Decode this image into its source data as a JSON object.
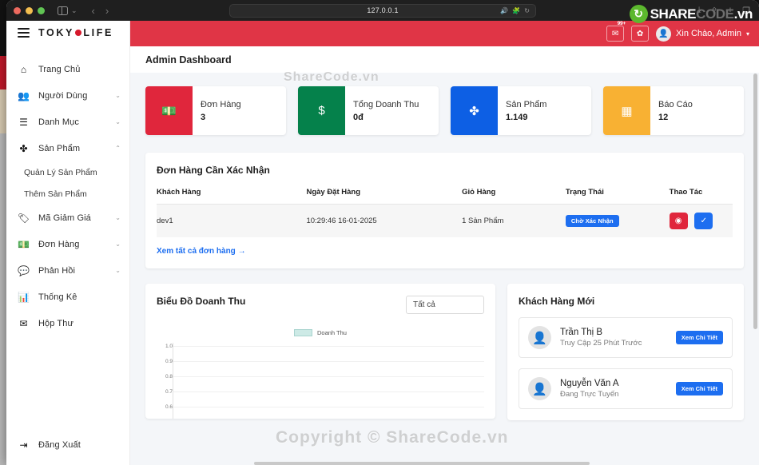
{
  "browser": {
    "url": "127.0.0.1",
    "back_icon": "chevron-left-icon",
    "forward_icon": "chevron-right-icon",
    "sidebar_icon": "sidebar-toggle-icon",
    "sound_icon": "🔊",
    "extension_icon": "🧩",
    "reload_icon": "↻",
    "download_icon": "⤓",
    "share_icon": "⇪",
    "newtab_icon": "+",
    "tabs_icon": "❐"
  },
  "watermark": {
    "badge": "↻",
    "share": "SHARE",
    "code": "CODE",
    "vn": ".vn",
    "top_text": "ShareCode.vn",
    "mid_text": "Copyright © ShareCode.vn"
  },
  "brand": {
    "hamburger_icon": "menu-icon",
    "name_left": "TOKY",
    "name_right": "LIFE"
  },
  "topbar": {
    "mail_icon": "✉",
    "mail_badge": "99+",
    "settings_icon": "✿",
    "avatar_icon": "👤",
    "greeting": "Xin Chào, Admin",
    "caret": "▾"
  },
  "page": {
    "title": "Admin Dashboard"
  },
  "sidebar": {
    "items": [
      {
        "label": "Trang Chủ",
        "icon": "home-icon",
        "glyph": "⌂",
        "caret": "",
        "expanded": false
      },
      {
        "label": "Người Dùng",
        "icon": "users-icon",
        "glyph": "👥",
        "caret": "⌄",
        "expanded": false
      },
      {
        "label": "Danh Mục",
        "icon": "layers-icon",
        "glyph": "☰",
        "caret": "⌄",
        "expanded": false
      },
      {
        "label": "Sản Phẩm",
        "icon": "product-icon",
        "glyph": "✤",
        "caret": "⌃",
        "expanded": true
      },
      {
        "label": "Mã Giảm Giá",
        "icon": "tag-icon",
        "glyph": "🏷",
        "caret": "⌄",
        "expanded": false
      },
      {
        "label": "Đơn Hàng",
        "icon": "money-icon",
        "glyph": "💵",
        "caret": "⌄",
        "expanded": false
      },
      {
        "label": "Phản Hồi",
        "icon": "comment-icon",
        "glyph": "💬",
        "caret": "⌄",
        "expanded": false
      },
      {
        "label": "Thống Kê",
        "icon": "chart-bar-icon",
        "glyph": "📊",
        "caret": "",
        "expanded": false
      },
      {
        "label": "Hộp Thư",
        "icon": "envelope-icon",
        "glyph": "✉",
        "caret": "",
        "expanded": false
      }
    ],
    "product_subitems": [
      {
        "label": "Quản Lý Sản Phẩm"
      },
      {
        "label": "Thêm Sản Phẩm"
      }
    ],
    "logout": {
      "label": "Đăng Xuất",
      "icon": "logout-icon",
      "glyph": "⇥"
    }
  },
  "stats": [
    {
      "label": "Đơn Hàng",
      "value": "3",
      "icon": "money-icon",
      "glyph": "💵",
      "color": "#e0263c"
    },
    {
      "label": "Tổng Doanh Thu",
      "value": "0đ",
      "icon": "dollar-icon",
      "glyph": "$",
      "color": "#05814b"
    },
    {
      "label": "Sản Phẩm",
      "value": "1.149",
      "icon": "product-icon",
      "glyph": "✤",
      "color": "#0d5fe4"
    },
    {
      "label": "Báo Cáo",
      "value": "12",
      "icon": "calendar-icon",
      "glyph": "▦",
      "color": "#f8b133"
    }
  ],
  "orders": {
    "title": "Đơn Hàng Cần Xác Nhận",
    "columns": [
      "Khách Hàng",
      "Ngày Đặt Hàng",
      "Giỏ Hàng",
      "Trạng Thái",
      "Thao Tác"
    ],
    "rows": [
      {
        "customer": "dev1",
        "date": "10:29:46 16-01-2025",
        "cart": "1 Sản Phẩm",
        "status": "Chờ Xác Nhận",
        "view_icon": "eye-icon",
        "view_glyph": "◉",
        "confirm_icon": "check-icon",
        "confirm_glyph": "✓"
      }
    ],
    "view_all": "Xem tất cả đơn hàng →"
  },
  "chart_data": {
    "type": "bar",
    "title": "Biểu Đồ Doanh Thu",
    "filter_value": "Tất cả",
    "legend": [
      "Doanh Thu"
    ],
    "legend_position": "top",
    "legend_color": "#cdeae6",
    "categories": [],
    "values": [],
    "xlabel": "",
    "ylabel": "",
    "ylim": [
      0.6,
      1.0
    ],
    "yticks": [
      "1.0",
      "0.9",
      "0.8",
      "0.7",
      "0.6"
    ],
    "grid": true
  },
  "customers": {
    "title": "Khách Hàng Mới",
    "items": [
      {
        "name": "Trần Thị B",
        "status": "Truy Cập 25 Phút Trước",
        "button": "Xem Chi Tiết",
        "avatar_icon": "user-avatar-icon",
        "glyph": "👤"
      },
      {
        "name": "Nguyễn Văn A",
        "status": "Đang Trực Tuyến",
        "button": "Xem Chi Tiết",
        "avatar_icon": "user-avatar-icon",
        "glyph": "👤"
      }
    ]
  }
}
